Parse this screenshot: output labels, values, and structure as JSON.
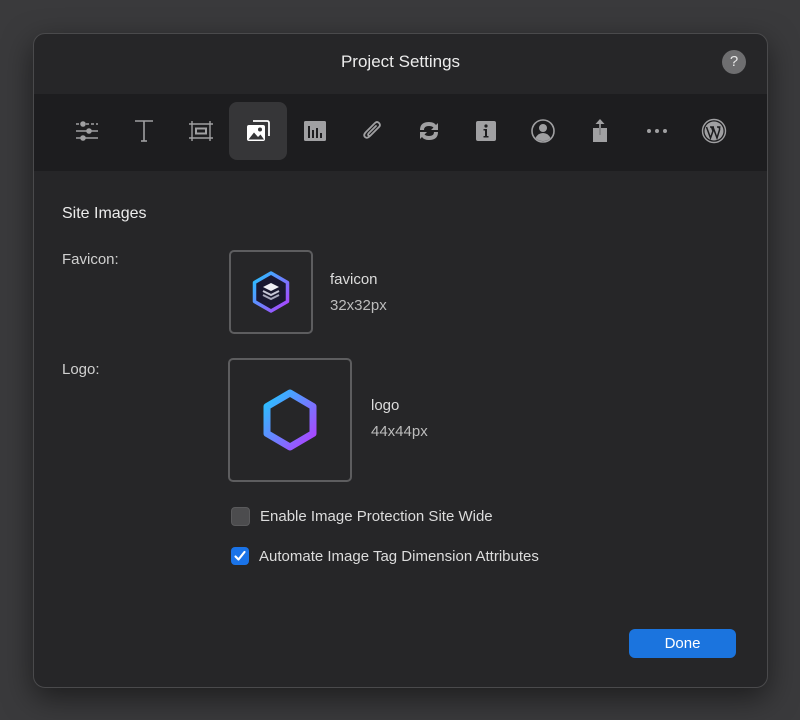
{
  "dialog": {
    "title": "Project Settings",
    "help_label": "?"
  },
  "toolbar": {
    "items": [
      {
        "name": "general",
        "icon": "sliders-icon",
        "active": false
      },
      {
        "name": "fonts",
        "icon": "text-icon",
        "active": false
      },
      {
        "name": "layout",
        "icon": "layout-frame-icon",
        "active": false
      },
      {
        "name": "images",
        "icon": "photos-icon",
        "active": true
      },
      {
        "name": "analytics",
        "icon": "chart-icon",
        "active": false
      },
      {
        "name": "attachments",
        "icon": "paperclip-icon",
        "active": false
      },
      {
        "name": "sync",
        "icon": "sync-icon",
        "active": false
      },
      {
        "name": "info",
        "icon": "info-icon",
        "active": false
      },
      {
        "name": "account",
        "icon": "person-circle-icon",
        "active": false
      },
      {
        "name": "publish",
        "icon": "share-icon",
        "active": false
      },
      {
        "name": "more",
        "icon": "ellipsis-icon",
        "active": false
      },
      {
        "name": "wordpress",
        "icon": "wordpress-icon",
        "active": false
      }
    ]
  },
  "site_images": {
    "section_title": "Site Images",
    "favicon": {
      "label": "Favicon:",
      "name": "favicon",
      "size": "32x32px"
    },
    "logo": {
      "label": "Logo:",
      "name": "logo",
      "size": "44x44px"
    }
  },
  "options": {
    "image_protection": {
      "label": "Enable Image Protection Site Wide",
      "checked": false
    },
    "image_dimensions": {
      "label": "Automate Image Tag Dimension Attributes",
      "checked": true
    }
  },
  "footer": {
    "done_label": "Done"
  },
  "colors": {
    "accent": "#1b74de",
    "background": "#262628",
    "toolbar": "#1d1d1f",
    "hex_gradient_start": "#22c7ff",
    "hex_gradient_end": "#b43cff"
  }
}
